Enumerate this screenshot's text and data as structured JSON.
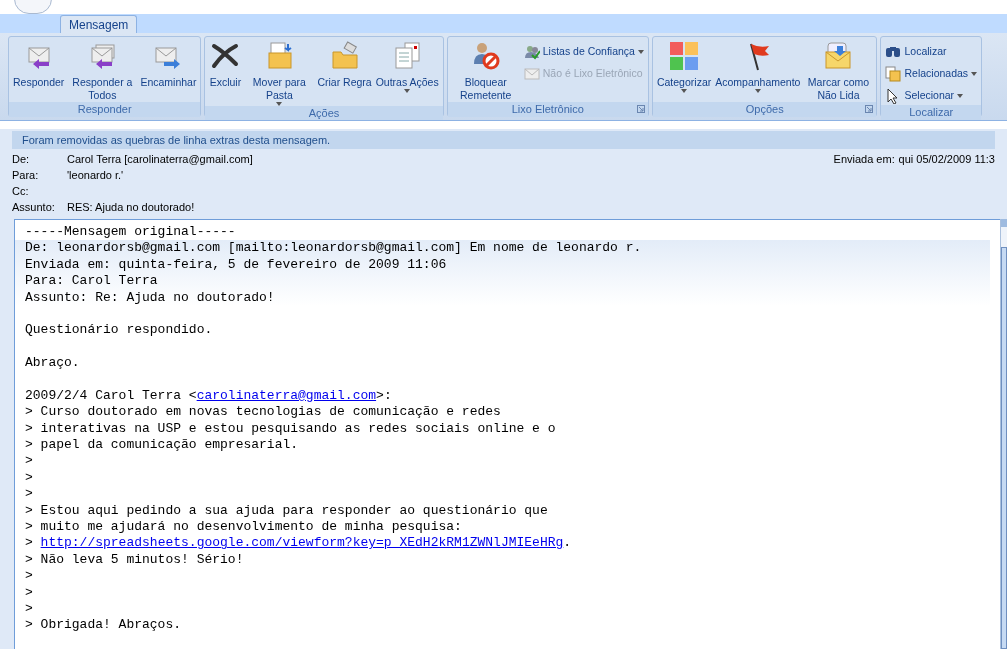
{
  "tabs": [
    {
      "label": "Mensagem",
      "selected": true
    }
  ],
  "ribbon": {
    "groups": [
      {
        "label": "Responder",
        "launcher": false,
        "buttons": [
          {
            "kind": "large",
            "label": "Responder",
            "dropdown": false,
            "disabled": false
          },
          {
            "kind": "large",
            "label": "Responder a Todos",
            "dropdown": false,
            "disabled": false
          },
          {
            "kind": "large",
            "label": "Encaminhar",
            "dropdown": false,
            "disabled": false
          }
        ]
      },
      {
        "label": "Ações",
        "launcher": false,
        "buttons": [
          {
            "kind": "large",
            "label": "Excluir",
            "dropdown": false,
            "disabled": false
          },
          {
            "kind": "large",
            "label": "Mover para Pasta",
            "dropdown": true,
            "disabled": false
          },
          {
            "kind": "large",
            "label": "Criar Regra",
            "dropdown": false,
            "disabled": false
          },
          {
            "kind": "large",
            "label": "Outras Ações",
            "dropdown": true,
            "disabled": false
          }
        ]
      },
      {
        "label": "Lixo Eletrônico",
        "launcher": true,
        "buttons": [
          {
            "kind": "large",
            "label": "Bloquear Remetente",
            "dropdown": false,
            "disabled": false
          },
          {
            "kind": "small",
            "label": "Listas de Confiança",
            "dropdown": true,
            "disabled": false
          },
          {
            "kind": "small",
            "label": "Não é Lixo Eletrônico",
            "dropdown": false,
            "disabled": true
          }
        ]
      },
      {
        "label": "Opções",
        "launcher": true,
        "buttons": [
          {
            "kind": "large",
            "label": "Categorizar",
            "dropdown": true,
            "disabled": false
          },
          {
            "kind": "large",
            "label": "Acompanhamento",
            "dropdown": true,
            "disabled": false
          },
          {
            "kind": "large",
            "label": "Marcar como Não Lida",
            "dropdown": false,
            "disabled": false
          }
        ]
      },
      {
        "label": "Localizar",
        "launcher": false,
        "buttons": [
          {
            "kind": "small",
            "label": "Localizar",
            "dropdown": false,
            "disabled": false
          },
          {
            "kind": "small",
            "label": "Relacionadas",
            "dropdown": true,
            "disabled": false
          },
          {
            "kind": "small",
            "label": "Selecionar",
            "dropdown": true,
            "disabled": false
          }
        ]
      }
    ]
  },
  "info_bar": "Foram removidas as quebras de linha extras desta mensagem.",
  "header": {
    "fields": [
      {
        "label": "De:",
        "value": "Carol Terra [carolinaterra@gmail.com]"
      },
      {
        "label": "Para:",
        "value": "'leonardo r.'"
      },
      {
        "label": "Cc:"
      },
      {
        "label": "Assunto:",
        "value": "RES: Ajuda no doutorado!"
      }
    ],
    "sent": {
      "label": "Enviada em:",
      "value": "qui 05/02/2009 11:3"
    }
  },
  "body": {
    "lines": [
      {
        "kind": "text",
        "text": "-----Mensagem original-----"
      },
      {
        "kind": "header",
        "text": "De: leonardorsb@gmail.com [mailto:leonardorsb@gmail.com] Em nome de leonardo r."
      },
      {
        "kind": "header",
        "text": "Enviada em: quinta-feira, 5 de fevereiro de 2009 11:06"
      },
      {
        "kind": "header",
        "text": "Para: Carol Terra"
      },
      {
        "kind": "header",
        "text": "Assunto: Re: Ajuda no doutorado!"
      },
      {
        "kind": "blank"
      },
      {
        "kind": "text",
        "text": "Questionário respondido."
      },
      {
        "kind": "blank"
      },
      {
        "kind": "text",
        "text": "Abraço."
      },
      {
        "kind": "blank"
      },
      {
        "kind": "link",
        "before": "2009/2/4 Carol Terra <",
        "link": "carolinaterra@gmail.com",
        "after": ">:"
      },
      {
        "kind": "text",
        "text": "> Curso doutorado em novas tecnologias de comunicação e redes"
      },
      {
        "kind": "text",
        "text": "> interativas na USP e estou pesquisando as redes sociais online e o"
      },
      {
        "kind": "text",
        "text": "> papel da comunicação empresarial."
      },
      {
        "kind": "text",
        "text": ">"
      },
      {
        "kind": "text",
        "text": ">"
      },
      {
        "kind": "text",
        "text": ">"
      },
      {
        "kind": "text",
        "text": "> Estou aqui pedindo a sua ajuda para responder ao questionário que"
      },
      {
        "kind": "text",
        "text": "> muito me ajudará no desenvolvimento de minha pesquisa:"
      },
      {
        "kind": "link",
        "before": "> ",
        "link": "http://spreadsheets.google.com/viewform?key=p_XEdH2kRM1ZWNlJMIEeHRg",
        "after": "."
      },
      {
        "kind": "text",
        "text": "> Não leva 5 minutos! Sério!"
      },
      {
        "kind": "text",
        "text": ">"
      },
      {
        "kind": "text",
        "text": ">"
      },
      {
        "kind": "text",
        "text": ">"
      },
      {
        "kind": "text",
        "text": "> Obrigada! Abraços."
      }
    ]
  }
}
